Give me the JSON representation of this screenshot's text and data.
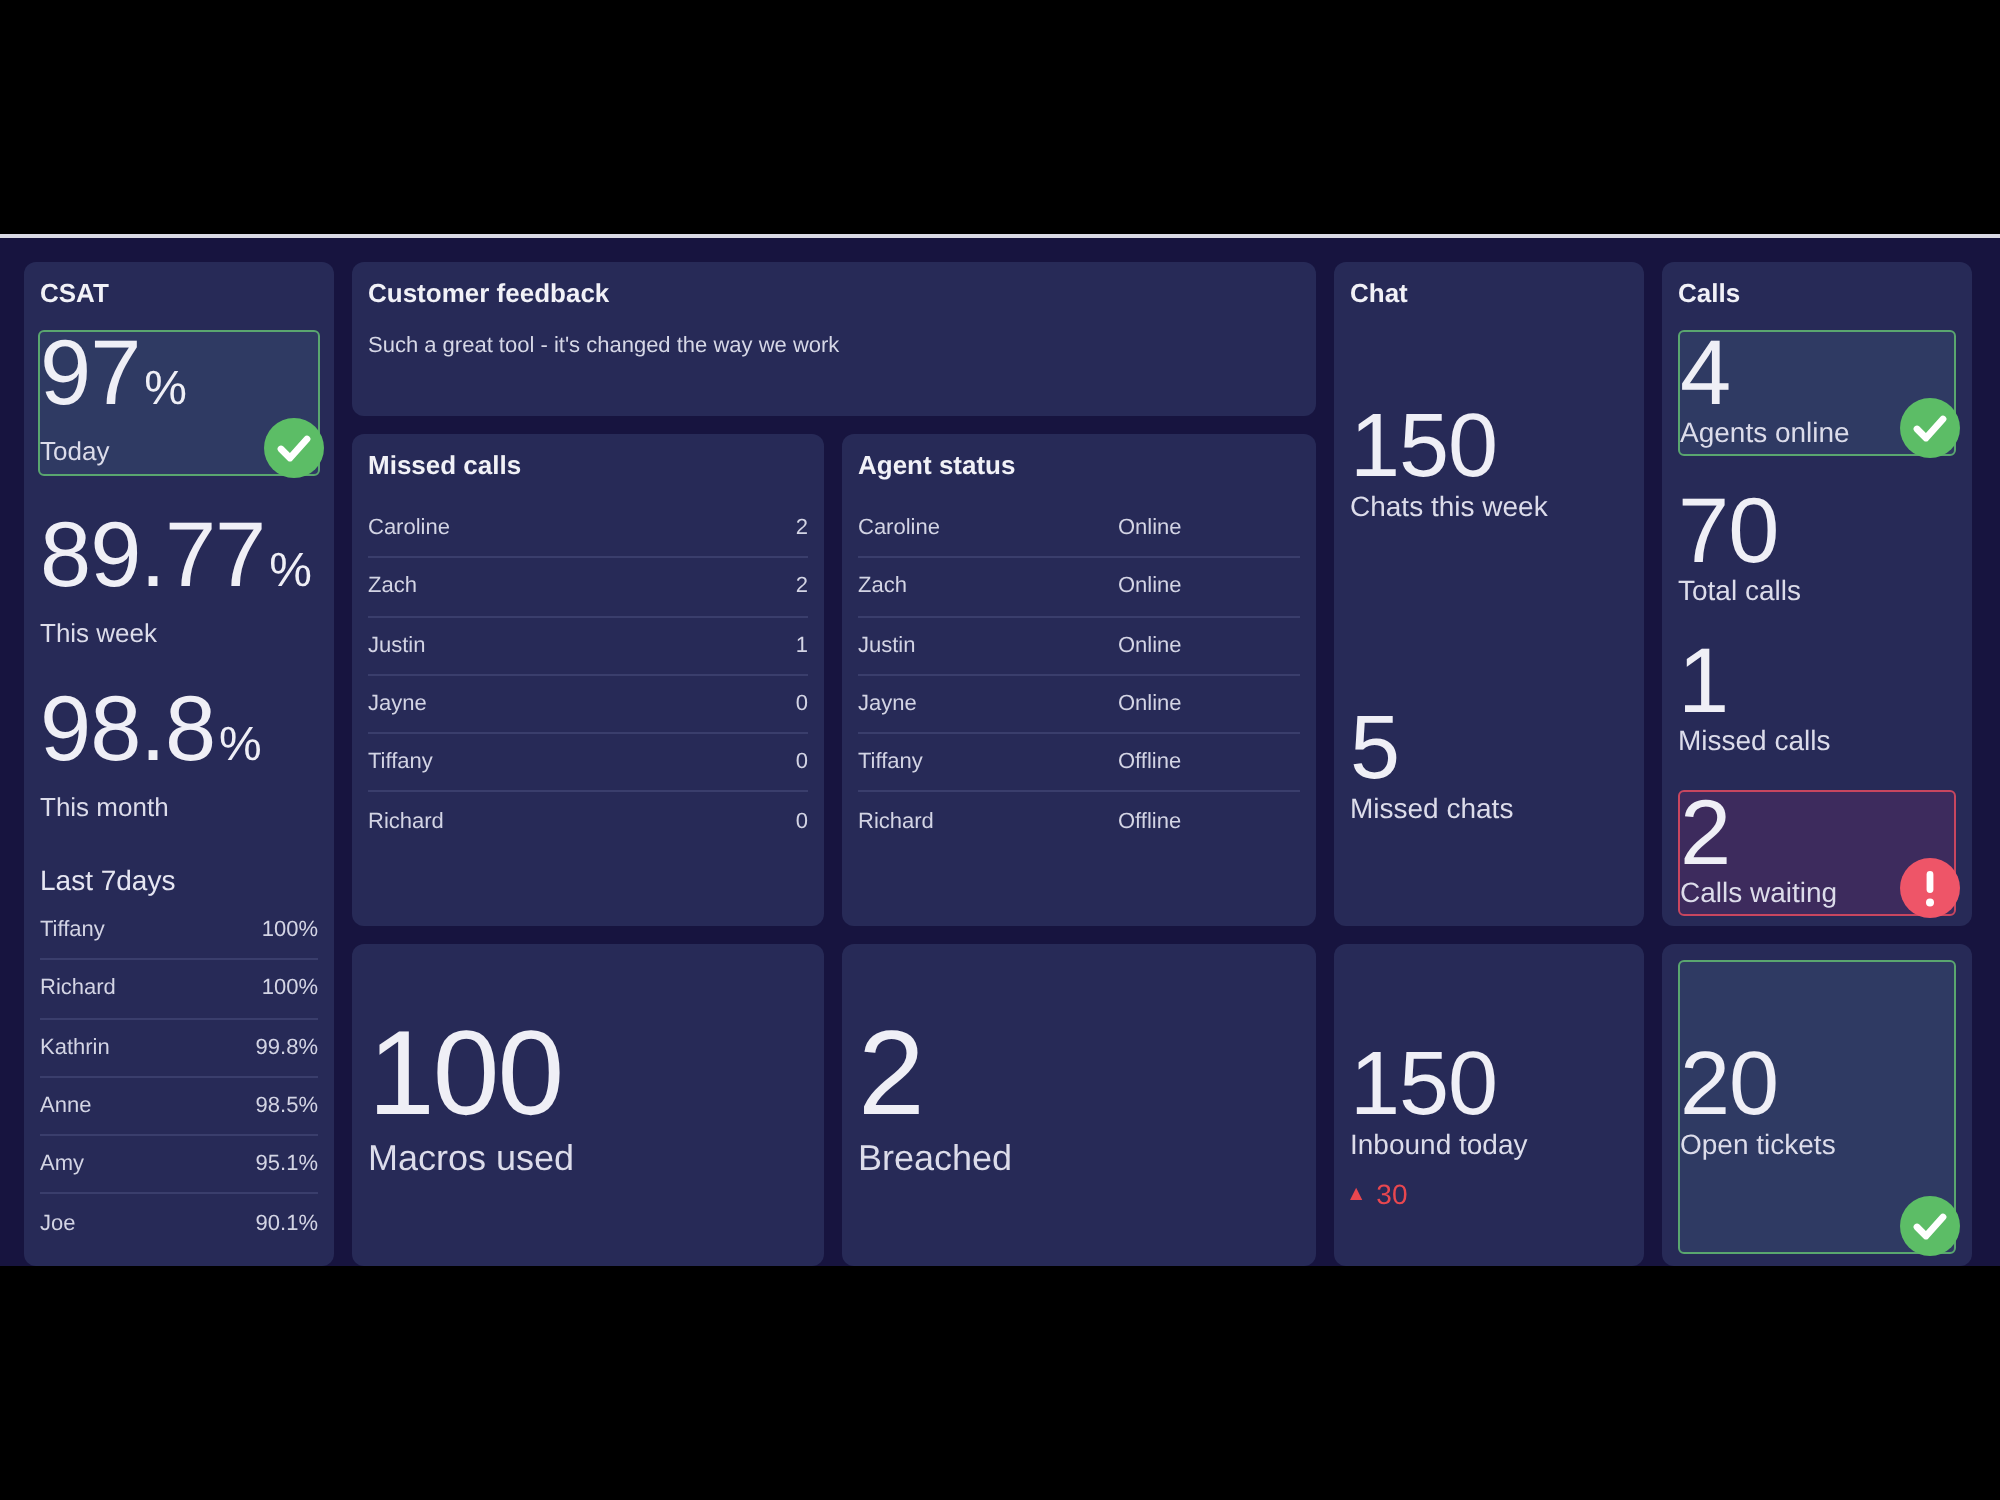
{
  "csat": {
    "title": "CSAT",
    "metrics": [
      {
        "kind": "success",
        "value": "97",
        "unit": "%",
        "label": "Today"
      },
      {
        "kind": "plain",
        "value": "89.77",
        "unit": "%",
        "label": "This week"
      },
      {
        "kind": "plain",
        "value": "98.8",
        "unit": "%",
        "label": "This month"
      }
    ],
    "breakdown": {
      "title": "Last 7days",
      "rows": [
        {
          "name": "Tiffany",
          "score": "100%"
        },
        {
          "name": "Richard",
          "score": "100%"
        },
        {
          "name": "Kathrin",
          "score": "99.8%"
        },
        {
          "name": "Anne",
          "score": "98.5%"
        },
        {
          "name": "Amy",
          "score": "95.1%"
        },
        {
          "name": "Joe",
          "score": "90.1%"
        }
      ]
    }
  },
  "customer_feedback": {
    "title": "Customer feedback",
    "text": "Such a great tool - it's changed the way we work"
  },
  "chat": {
    "title": "Chat",
    "metrics": [
      {
        "kind": "plain",
        "value": "150",
        "label": "Chats this week"
      },
      {
        "kind": "plain",
        "value": "5",
        "label": "Missed chats"
      }
    ]
  },
  "calls": {
    "title": "Calls",
    "metrics": [
      {
        "kind": "success",
        "value": "4",
        "label": "Agents online"
      },
      {
        "kind": "plain",
        "value": "70",
        "label": "Total calls"
      },
      {
        "kind": "plain",
        "value": "1",
        "label": "Missed calls"
      },
      {
        "kind": "alert",
        "value": "2",
        "label": "Calls waiting"
      }
    ]
  },
  "missed_calls": {
    "title": "Missed calls",
    "rows": [
      {
        "name": "Caroline",
        "count": "2"
      },
      {
        "name": "Zach",
        "count": "2"
      },
      {
        "name": "Justin",
        "count": "1"
      },
      {
        "name": "Jayne",
        "count": "0"
      },
      {
        "name": "Tiffany",
        "count": "0"
      },
      {
        "name": "Richard",
        "count": "0"
      }
    ]
  },
  "agent_status": {
    "title": "Agent status",
    "rows": [
      {
        "name": "Caroline",
        "status": "Online"
      },
      {
        "name": "Zach",
        "status": "Online"
      },
      {
        "name": "Justin",
        "status": "Online"
      },
      {
        "name": "Jayne",
        "status": "Online"
      },
      {
        "name": "Tiffany",
        "status": "Offline"
      },
      {
        "name": "Richard",
        "status": "Offline"
      }
    ]
  },
  "bottom_tiles": [
    {
      "kind": "plain",
      "value": "100",
      "label": "Macros used"
    },
    {
      "kind": "plain",
      "value": "2",
      "label": "Breached"
    },
    {
      "kind": "plain",
      "value": "150",
      "label": "Inbound today",
      "change": {
        "arrow": "▲",
        "value": "30"
      }
    },
    {
      "kind": "success",
      "value": "20",
      "label": "Open tickets"
    }
  ]
}
